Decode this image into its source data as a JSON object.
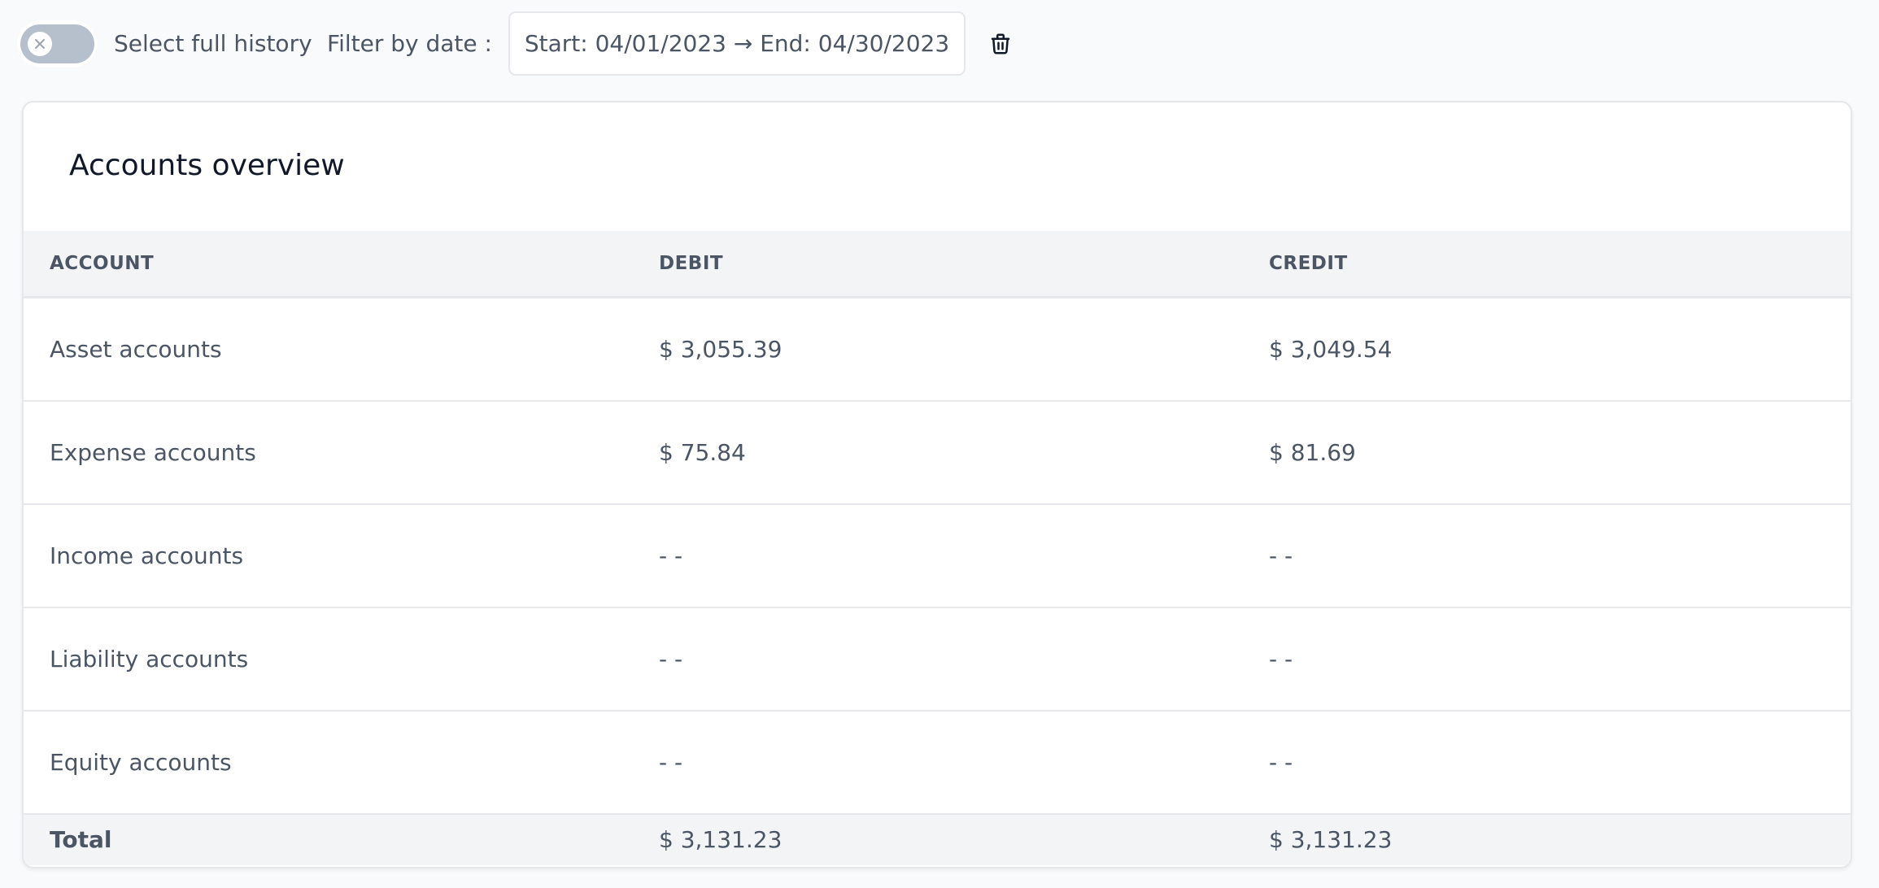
{
  "filters": {
    "full_history_label": "Select full history",
    "full_history_enabled": false,
    "filter_by_date_label": "Filter by date :",
    "date_range": "Start: 04/01/2023 → End: 04/30/2023"
  },
  "icons": {
    "toggle_knob": "x-icon",
    "clear_filter": "trash-icon"
  },
  "colors": {
    "toggle_track": "#b6c0cc",
    "header_background": "#f3f4f6",
    "text": "#4b5563",
    "title": "#111827"
  },
  "overview": {
    "title": "Accounts overview",
    "columns": [
      "ACCOUNT",
      "DEBIT",
      "CREDIT"
    ],
    "rows": [
      {
        "account": "Asset accounts",
        "debit": "$ 3,055.39",
        "credit": "$ 3,049.54"
      },
      {
        "account": "Expense accounts",
        "debit": "$ 75.84",
        "credit": "$ 81.69"
      },
      {
        "account": "Income accounts",
        "debit": "- -",
        "credit": "- -"
      },
      {
        "account": "Liability accounts",
        "debit": "- -",
        "credit": "- -"
      },
      {
        "account": "Equity accounts",
        "debit": "- -",
        "credit": "- -"
      }
    ],
    "total": {
      "label": "Total",
      "debit": "$ 3,131.23",
      "credit": "$ 3,131.23"
    }
  }
}
